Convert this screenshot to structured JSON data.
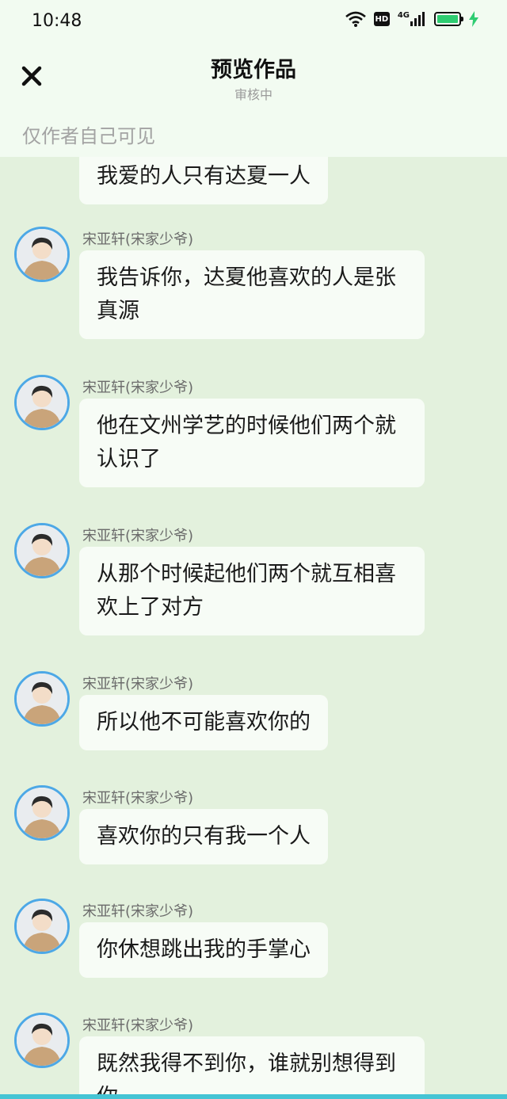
{
  "status_bar": {
    "time": "10:48",
    "hd_label": "HD",
    "network_label": "4G",
    "battery_color": "#2ecc71"
  },
  "header": {
    "title": "预览作品",
    "subtitle": "审核中",
    "close_icon": "close-icon",
    "notice": "仅作者自己可见"
  },
  "messages": [
    {
      "sender": "",
      "text": "我爱的人只有达夏一人"
    },
    {
      "sender": "宋亚轩(宋家少爷)",
      "text": "我告诉你，达夏他喜欢的人是张真源"
    },
    {
      "sender": "宋亚轩(宋家少爷)",
      "text": "他在文州学艺的时候他们两个就认识了"
    },
    {
      "sender": "宋亚轩(宋家少爷)",
      "text": "从那个时候起他们两个就互相喜欢上了对方"
    },
    {
      "sender": "宋亚轩(宋家少爷)",
      "text": "所以他不可能喜欢你的"
    },
    {
      "sender": "宋亚轩(宋家少爷)",
      "text": "喜欢你的只有我一个人"
    },
    {
      "sender": "宋亚轩(宋家少爷)",
      "text": "你休想跳出我的手掌心"
    },
    {
      "sender": "宋亚轩(宋家少爷)",
      "text": "既然我得不到你，谁就别想得到你"
    }
  ]
}
